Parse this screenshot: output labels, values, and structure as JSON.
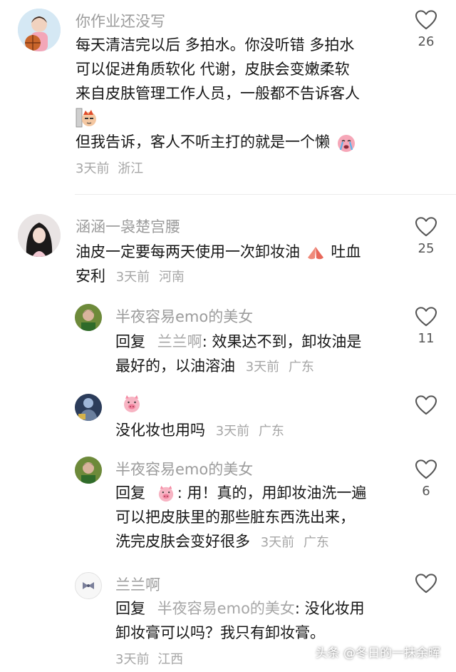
{
  "comments": [
    {
      "user": "你作业还没写",
      "lines": [
        "每天清洁完以后  多拍水。你没听错  多拍水",
        "可以促进角质软化 代谢，皮肤会变嫩柔软",
        "来自皮肤管理工作人员，一般都不告诉客人",
        "但我告诉，客人不听主打的就是一个懒"
      ],
      "time": "3天前",
      "location": "浙江",
      "likes": "26"
    },
    {
      "user": "涵涵一袅楚宫腰",
      "lines": [
        "油皮一定要每两天使用一次卸妆油",
        "吐血",
        "安利"
      ],
      "time": "3天前",
      "location": "河南",
      "likes": "25"
    }
  ],
  "replies": [
    {
      "user": "半夜容易emo的美女",
      "reply_word": "回复",
      "mention": "兰兰啊",
      "lines": [
        ": 效果达不到，卸妆油是",
        "最好的，以油溶油"
      ],
      "time": "3天前",
      "location": "广东",
      "likes": "11"
    },
    {
      "user": "",
      "lines": [
        "没化妆也用吗"
      ],
      "time": "3天前",
      "location": "广东",
      "likes": ""
    },
    {
      "user": "半夜容易emo的美女",
      "reply_word": "回复",
      "lines": [
        ": 用！真的，用卸妆油洗一遍",
        "可以把皮肤里的那些脏东西洗出来，",
        "洗完皮肤会变好很多"
      ],
      "time": "3天前",
      "location": "广东",
      "likes": "6"
    },
    {
      "user": "兰兰啊",
      "reply_word": "回复",
      "mention": "半夜容易emo的美女",
      "lines": [
        ": 没化妆用",
        "卸妆膏可以吗？我只有卸妆膏。"
      ],
      "time": "3天前",
      "location": "江西",
      "likes": ""
    }
  ],
  "watermark": "头条 @冬日的一抹余晖"
}
